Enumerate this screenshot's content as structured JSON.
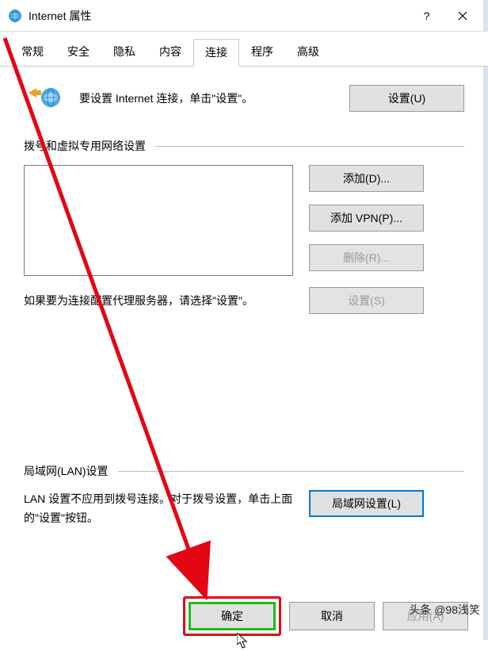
{
  "window": {
    "title": "Internet 属性"
  },
  "tabs": [
    "常规",
    "安全",
    "隐私",
    "内容",
    "连接",
    "程序",
    "高级"
  ],
  "hero": {
    "text": "要设置 Internet 连接，单击\"设置\"。",
    "setup_btn": "设置(U)"
  },
  "dial": {
    "title": "拨号和虚拟专用网络设置",
    "add_btn": "添加(D)...",
    "add_vpn_btn": "添加 VPN(P)...",
    "remove_btn": "删除(R)...",
    "proxy_text": "如果要为连接配置代理服务器，请选择\"设置\"。",
    "settings_btn": "设置(S)"
  },
  "lan": {
    "title": "局域网(LAN)设置",
    "text": "LAN 设置不应用到拨号连接。对于拨号设置，单击上面的\"设置\"按钮。",
    "btn": "局域网设置(L)"
  },
  "footer": {
    "ok": "确定",
    "cancel": "取消",
    "apply": "应用(A)"
  },
  "watermark": "头条 @98浅笑"
}
